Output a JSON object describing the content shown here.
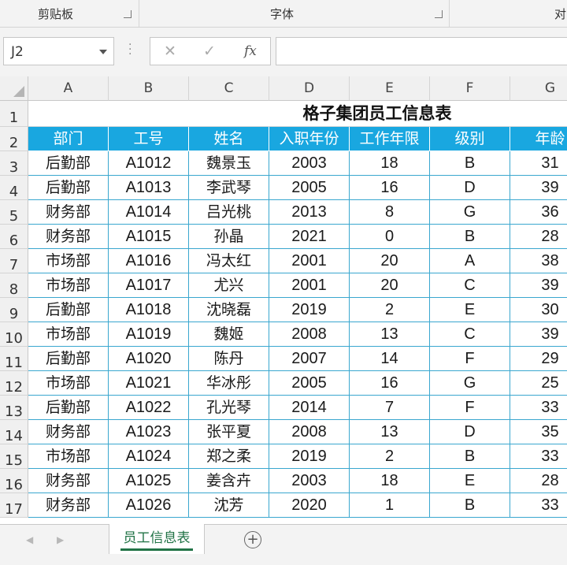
{
  "ribbon": {
    "groups": [
      {
        "label": "剪贴板"
      },
      {
        "label": "字体"
      },
      {
        "label": "对"
      }
    ]
  },
  "formula_bar": {
    "name_box": "J2",
    "cancel_icon": "✕",
    "enter_icon": "✓",
    "fx_label": "fx",
    "formula": ""
  },
  "columns": [
    "A",
    "B",
    "C",
    "D",
    "E",
    "F",
    "G"
  ],
  "rows": [
    "1",
    "2",
    "3",
    "4",
    "5",
    "6",
    "7",
    "8",
    "9",
    "10",
    "11",
    "12",
    "13",
    "14",
    "15",
    "16",
    "17"
  ],
  "sheet_title": "格子集团员工信息表",
  "table": {
    "headers": [
      "部门",
      "工号",
      "姓名",
      "入职年份",
      "工作年限",
      "级别",
      "年龄"
    ],
    "rows": [
      [
        "后勤部",
        "A1012",
        "魏景玉",
        "2003",
        "18",
        "B",
        "31"
      ],
      [
        "后勤部",
        "A1013",
        "李武琴",
        "2005",
        "16",
        "D",
        "39"
      ],
      [
        "财务部",
        "A1014",
        "吕光桃",
        "2013",
        "8",
        "G",
        "36"
      ],
      [
        "财务部",
        "A1015",
        "孙晶",
        "2021",
        "0",
        "B",
        "28"
      ],
      [
        "市场部",
        "A1016",
        "冯太红",
        "2001",
        "20",
        "A",
        "38"
      ],
      [
        "市场部",
        "A1017",
        "尤兴",
        "2001",
        "20",
        "C",
        "39"
      ],
      [
        "后勤部",
        "A1018",
        "沈晓磊",
        "2019",
        "2",
        "E",
        "30"
      ],
      [
        "市场部",
        "A1019",
        "魏姬",
        "2008",
        "13",
        "C",
        "39"
      ],
      [
        "后勤部",
        "A1020",
        "陈丹",
        "2007",
        "14",
        "F",
        "29"
      ],
      [
        "市场部",
        "A1021",
        "华冰彤",
        "2005",
        "16",
        "G",
        "25"
      ],
      [
        "后勤部",
        "A1022",
        "孔光琴",
        "2014",
        "7",
        "F",
        "33"
      ],
      [
        "财务部",
        "A1023",
        "张平夏",
        "2008",
        "13",
        "D",
        "35"
      ],
      [
        "市场部",
        "A1024",
        "郑之柔",
        "2019",
        "2",
        "B",
        "33"
      ],
      [
        "财务部",
        "A1025",
        "姜含卉",
        "2003",
        "18",
        "E",
        "28"
      ],
      [
        "财务部",
        "A1026",
        "沈芳",
        "2020",
        "1",
        "B",
        "33"
      ]
    ]
  },
  "sheet_tabs": [
    {
      "label": "员工信息表",
      "active": true
    }
  ],
  "add_sheet_icon": "⊕",
  "colors": {
    "header_fill": "#19a7e0",
    "border": "#3aa7cf",
    "active_tab": "#217346"
  }
}
